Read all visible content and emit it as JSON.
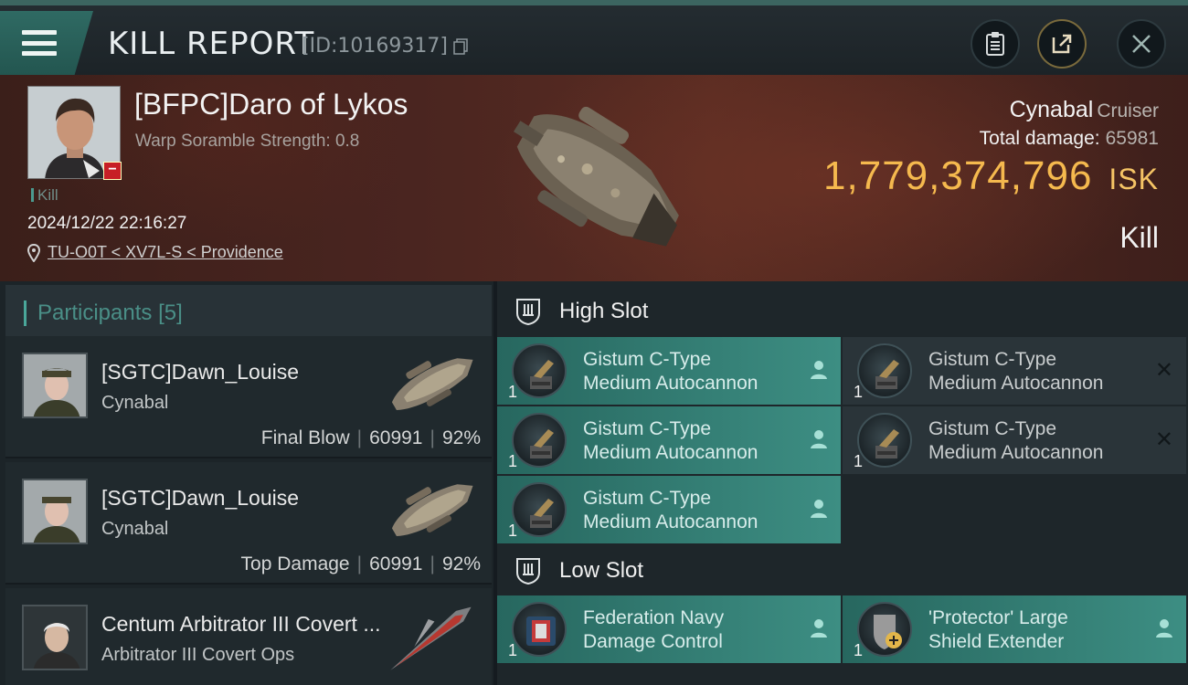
{
  "topbar": {
    "title": "KILL REPORT",
    "id_text": "[ID:10169317]",
    "icons": [
      "menu-icon",
      "copy-icon",
      "clipboard-icon",
      "share-icon",
      "close-icon"
    ]
  },
  "victim": {
    "name": "[BFPC]Daro of Lykos",
    "warp_scramble": "Warp Soramble Strength: 0.8",
    "kill_tag": "Kill",
    "datetime": "2024/12/22 22:16:27",
    "location": "TU-O0T < XV7L-S < Providence",
    "ship": "Cynabal",
    "ship_class": "Cruiser",
    "total_damage_label": "Total damage:",
    "total_damage": "65981",
    "isk_value": "1,779,374,796",
    "isk_unit": "ISK",
    "result": "Kill"
  },
  "participants": {
    "header": "Participants",
    "count": "[5]",
    "rows": [
      {
        "name": "[SGTC]Dawn_Louise",
        "ship": "Cynabal",
        "role": "Final Blow",
        "damage": "60991",
        "percent": "92%"
      },
      {
        "name": "[SGTC]Dawn_Louise",
        "ship": "Cynabal",
        "role": "Top Damage",
        "damage": "60991",
        "percent": "92%"
      },
      {
        "name": "Centum Arbitrator III Covert ...",
        "ship": "Arbitrator III Covert Ops"
      }
    ]
  },
  "fitting": {
    "high_slot_label": "High Slot",
    "low_slot_label": "Low Slot",
    "high_slots": [
      {
        "line1": "Gistum C-Type",
        "line2": "Medium Autocannon",
        "qty": "1",
        "state": "dropped"
      },
      {
        "line1": "Gistum C-Type",
        "line2": "Medium Autocannon",
        "qty": "1",
        "state": "destroyed"
      },
      {
        "line1": "Gistum C-Type",
        "line2": "Medium Autocannon",
        "qty": "1",
        "state": "dropped"
      },
      {
        "line1": "Gistum C-Type",
        "line2": "Medium Autocannon",
        "qty": "1",
        "state": "destroyed"
      },
      {
        "line1": "Gistum C-Type",
        "line2": "Medium Autocannon",
        "qty": "1",
        "state": "dropped"
      }
    ],
    "low_slots": [
      {
        "line1": "Federation Navy",
        "line2": "Damage Control",
        "qty": "1",
        "state": "dropped"
      },
      {
        "line1": "'Protector' Large",
        "line2": "Shield Extender",
        "qty": "1",
        "state": "dropped"
      }
    ]
  },
  "colors": {
    "accent_teal": "#3d8e83",
    "isk_gold": "#f5b94e",
    "loss_red": "#c71f26"
  }
}
